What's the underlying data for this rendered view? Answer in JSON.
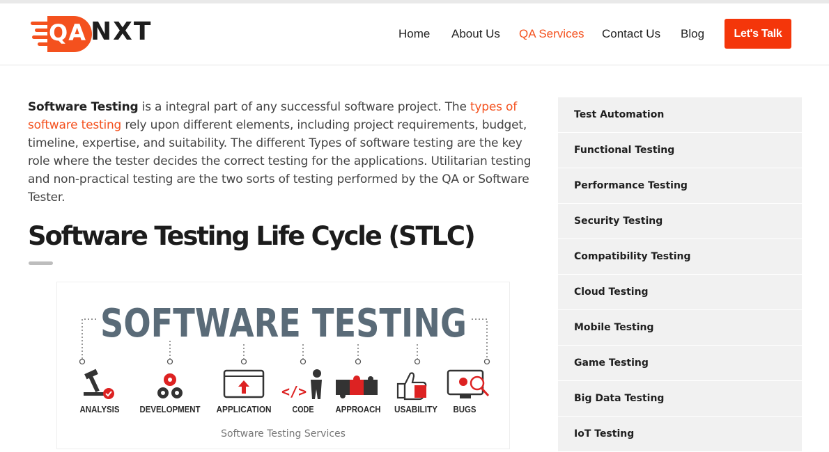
{
  "brand": {
    "logo_prefix": "QA",
    "logo_suffix": "NXT",
    "accent": "#f4511e",
    "cta_color": "#f4360a"
  },
  "nav": {
    "items": [
      {
        "label": "Home"
      },
      {
        "label": "About Us"
      },
      {
        "label": "QA Services",
        "active": true
      },
      {
        "label": "Contact Us"
      },
      {
        "label": "Blog"
      }
    ],
    "cta": "Let's Talk"
  },
  "article": {
    "intro": {
      "bold_lead": "Software Testing",
      "text_1": " is a integral part of any successful software project. The ",
      "link": "types of software testing",
      "text_2": " rely upon different elements, including project requirements, budget, timeline, expertise, and suitability. The different Types of software testing are the key role where the tester decides the correct testing for the applications. Utilitarian testing and non-practical testing are the two sorts of testing performed by the QA or Software Tester."
    },
    "heading": "Software Testing Life Cycle (STLC)",
    "figure": {
      "title": "SOFTWARE TESTING",
      "caption": "Software Testing Services",
      "labels": [
        "ANALYSIS",
        "DEVELOPMENT",
        "APPLICATION",
        "CODE",
        "APPROACH",
        "USABILITY",
        "BUGS"
      ],
      "icons": [
        "microscope-icon",
        "gears-icon",
        "browser-upload-icon",
        "coder-icon",
        "puzzle-icon",
        "thumbs-up-icon",
        "bug-search-icon"
      ]
    }
  },
  "sidebar": {
    "items": [
      {
        "label": "Test Automation"
      },
      {
        "label": "Functional Testing"
      },
      {
        "label": "Performance Testing"
      },
      {
        "label": "Security Testing"
      },
      {
        "label": "Compatibility Testing"
      },
      {
        "label": "Cloud Testing"
      },
      {
        "label": "Mobile Testing"
      },
      {
        "label": "Game Testing"
      },
      {
        "label": "Big Data Testing"
      },
      {
        "label": "IoT Testing"
      }
    ]
  }
}
